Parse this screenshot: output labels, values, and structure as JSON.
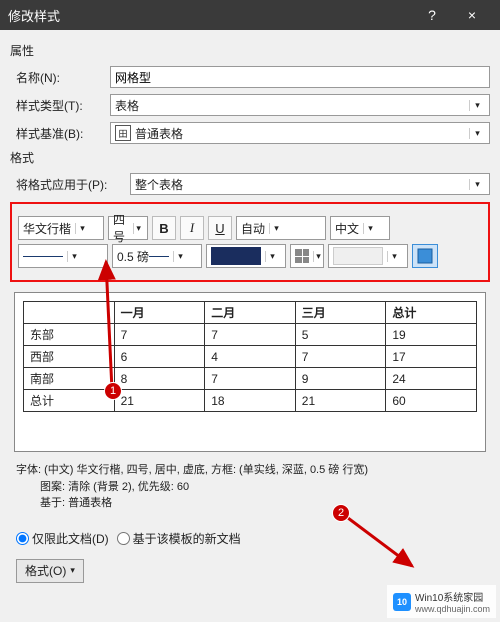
{
  "titlebar": {
    "title": "修改样式",
    "help": "?",
    "close": "×"
  },
  "sections": {
    "properties": "属性",
    "format": "格式"
  },
  "labels": {
    "name": "名称(N):",
    "style_type": "样式类型(T):",
    "style_base": "样式基准(B):",
    "apply_to": "将格式应用于(P):"
  },
  "values": {
    "name": "网格型",
    "style_type": "表格",
    "style_base": "普通表格",
    "apply_to": "整个表格"
  },
  "formatting": {
    "font_name": "华文行楷",
    "font_size": "四号",
    "bold": "B",
    "italic": "I",
    "underline": "U",
    "text_color": "自动",
    "script": "中文",
    "line_weight": "0.5 磅"
  },
  "preview_table": {
    "headers": [
      "",
      "一月",
      "二月",
      "三月",
      "总计"
    ],
    "rows": [
      [
        "东部",
        "7",
        "7",
        "5",
        "19"
      ],
      [
        "西部",
        "6",
        "4",
        "7",
        "17"
      ],
      [
        "南部",
        "8",
        "7",
        "9",
        "24"
      ],
      [
        "总计",
        "21",
        "18",
        "21",
        "60"
      ]
    ]
  },
  "description": {
    "line1": "字体: (中文) 华文行楷, 四号, 居中, 虚底, 方框: (单实线, 深蓝, 0.5 磅 行宽)",
    "line2": "图案: 清除 (背景 2), 优先级: 60",
    "line3": "基于: 普通表格"
  },
  "radios": {
    "this_doc": "仅限此文档(D)",
    "new_docs": "基于该模板的新文档"
  },
  "footer": {
    "format_btn": "格式(O)"
  },
  "annotations": {
    "badge1": "1",
    "badge2": "2"
  },
  "watermark": {
    "logo": "10",
    "line1": "Win10系统家园",
    "line2": "www.qdhuajin.com"
  }
}
